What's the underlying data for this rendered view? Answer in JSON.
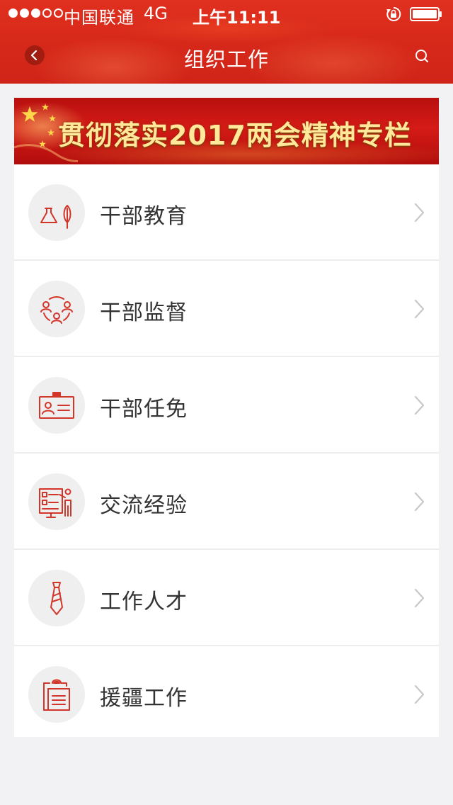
{
  "status_bar": {
    "carrier": "中国联通",
    "network": "4G",
    "time": "上午11:11",
    "signal_strength": "3 of 5"
  },
  "nav": {
    "title": "组织工作",
    "back_icon": "chevron-left-icon",
    "search_icon": "search-icon"
  },
  "banner": {
    "text": "贯彻落实2017两会精神专栏"
  },
  "menu": {
    "items": [
      {
        "label": "干部教育",
        "icon": "education-icon"
      },
      {
        "label": "干部监督",
        "icon": "supervision-icon"
      },
      {
        "label": "干部任免",
        "icon": "id-card-icon"
      },
      {
        "label": "交流经验",
        "icon": "presentation-icon"
      },
      {
        "label": "工作人才",
        "icon": "tie-icon"
      },
      {
        "label": "援疆工作",
        "icon": "clipboard-icon"
      }
    ]
  },
  "colors": {
    "header": "#d92a1b",
    "icon_accent": "#d2352a",
    "banner_text": "#ffe89a",
    "background": "#f2f2f4"
  }
}
